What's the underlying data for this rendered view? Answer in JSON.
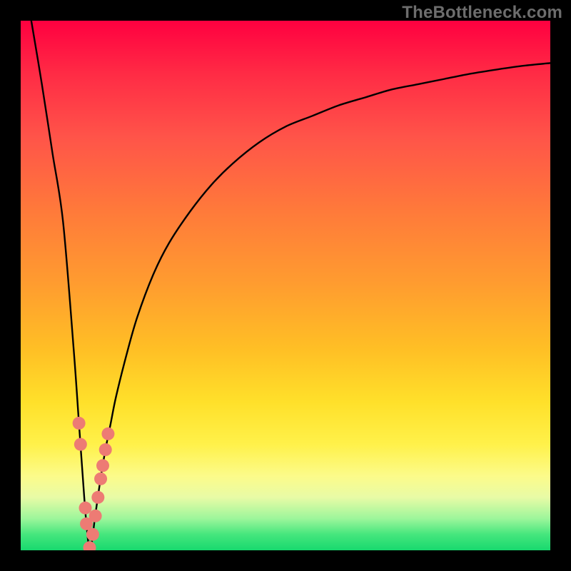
{
  "watermark": "TheBottleneck.com",
  "chart_data": {
    "type": "line",
    "title": "",
    "xlabel": "",
    "ylabel": "",
    "xlim": [
      0,
      100
    ],
    "ylim": [
      0,
      100
    ],
    "series": [
      {
        "name": "bottleneck-curve",
        "x": [
          2,
          4,
          6,
          8,
          10,
          11,
          12,
          12.5,
          13,
          13.5,
          14,
          15,
          16,
          17,
          18,
          20,
          22,
          25,
          28,
          32,
          36,
          40,
          45,
          50,
          55,
          60,
          65,
          70,
          75,
          80,
          85,
          90,
          95,
          100
        ],
        "y": [
          100,
          88,
          75,
          62,
          38,
          24,
          10,
          4,
          0,
          2,
          6,
          13,
          19,
          24,
          29,
          37,
          44,
          52,
          58,
          64,
          69,
          73,
          77,
          80,
          82,
          84,
          85.5,
          87,
          88,
          89,
          90,
          90.8,
          91.5,
          92
        ]
      }
    ],
    "markers": [
      {
        "name": "dot-left-1",
        "x": 11.0,
        "y": 24
      },
      {
        "name": "dot-left-2",
        "x": 11.3,
        "y": 20
      },
      {
        "name": "dot-left-3",
        "x": 12.2,
        "y": 8
      },
      {
        "name": "dot-left-4",
        "x": 12.4,
        "y": 5
      },
      {
        "name": "dot-min",
        "x": 13.0,
        "y": 0.5
      },
      {
        "name": "dot-right-1",
        "x": 13.6,
        "y": 3
      },
      {
        "name": "dot-right-2",
        "x": 14.1,
        "y": 6.5
      },
      {
        "name": "dot-right-3",
        "x": 14.6,
        "y": 10
      },
      {
        "name": "dot-right-4",
        "x": 15.1,
        "y": 13.5
      },
      {
        "name": "dot-right-5",
        "x": 15.5,
        "y": 16
      },
      {
        "name": "dot-right-6",
        "x": 16.0,
        "y": 19
      },
      {
        "name": "dot-right-7",
        "x": 16.5,
        "y": 22
      }
    ],
    "marker_color": "#ed7b74",
    "marker_radius": 9
  }
}
